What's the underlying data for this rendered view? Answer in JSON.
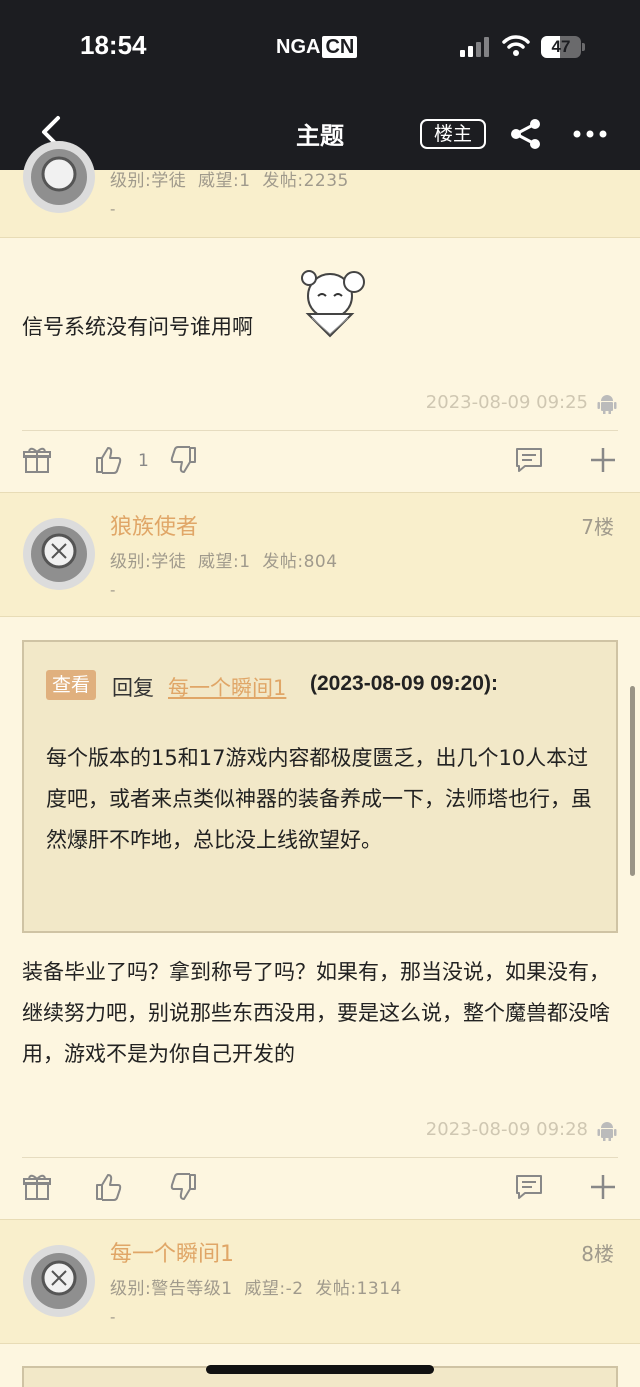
{
  "status_bar": {
    "time": "18:54",
    "logo": "NGA",
    "logo_suffix": "CN",
    "battery": "47",
    "battery_level": 0.47
  },
  "nav": {
    "title": "主题",
    "op_label": "楼主"
  },
  "post6": {
    "meta": "级别:学徒  威望:1  发帖:2235",
    "dash": "-",
    "text": "信号系统没有问号谁用啊",
    "time": "2023-08-09 09:25",
    "like_count": "1"
  },
  "post7": {
    "username": "狼族使者",
    "floor": "7楼",
    "meta": "级别:学徒  威望:1  发帖:804",
    "dash": "-",
    "quote": {
      "tag": "查看",
      "reply_label": "回复",
      "user": "每一个瞬间1",
      "time": "(2023-08-09 09:20):",
      "body": "每个版本的15和17游戏内容都极度匮乏，出几个10人本过度吧，或者来点类似神器的装备养成一下，法师塔也行，虽然爆肝不咋地，总比没上线欲望好。"
    },
    "text": "装备毕业了吗？拿到称号了吗？如果有，那当没说，如果没有，继续努力吧，别说那些东西没用，要是这么说，整个魔兽都没啥用，游戏不是为你自己开发的",
    "time": "2023-08-09 09:28"
  },
  "post8": {
    "username": "每一个瞬间1",
    "floor": "8楼",
    "meta": "级别:警告等级1  威望:-2  发帖:1314",
    "dash": "-"
  },
  "icons": [
    "back-icon",
    "share-icon",
    "more-icon",
    "gift-icon",
    "thumb-up-icon",
    "thumb-down-icon",
    "comment-icon",
    "plus-icon",
    "android-icon"
  ],
  "colors": {
    "accent": "#e0a667",
    "background": "#fdf6e0",
    "header_bg": "#f9efcc",
    "topbar": "#1c1d21"
  }
}
